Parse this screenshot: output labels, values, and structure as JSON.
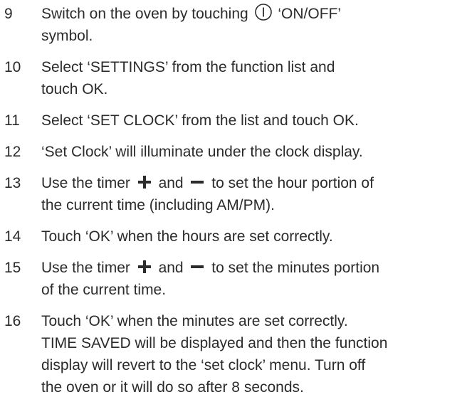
{
  "steps": [
    {
      "number": "9",
      "text_before_icon": "Switch on the oven by touching",
      "icon": "power-icon",
      "text_after_icon": "‘ON/OFF’",
      "line2": "symbol."
    },
    {
      "number": "10",
      "line1": "Select ‘SETTINGS’ from the function list and",
      "line2": "touch OK."
    },
    {
      "number": "11",
      "line1": "Select ‘SET CLOCK’ from the list and touch OK."
    },
    {
      "number": "12",
      "line1": "‘Set Clock’ will illuminate under the clock display."
    },
    {
      "number": "13",
      "seg1": "Use the timer",
      "icon_plus": "plus-icon",
      "seg2": "and",
      "icon_minus": "minus-icon",
      "seg3": "to set the hour portion of",
      "line2": "the current time (including AM/PM)."
    },
    {
      "number": "14",
      "line1": "Touch ‘OK’ when the hours are set correctly."
    },
    {
      "number": "15",
      "seg1": "Use the timer",
      "icon_plus": "plus-icon",
      "seg2": "and",
      "icon_minus": "minus-icon",
      "seg3": "to set the minutes portion",
      "line2": "of the current time."
    },
    {
      "number": "16",
      "lines": [
        "Touch ‘OK’ when the minutes are set correctly.",
        "TIME SAVED will be displayed and then the function",
        "display will revert to the ‘set clock’ menu. Turn off",
        "the oven or it will do so after 8 seconds."
      ]
    }
  ]
}
